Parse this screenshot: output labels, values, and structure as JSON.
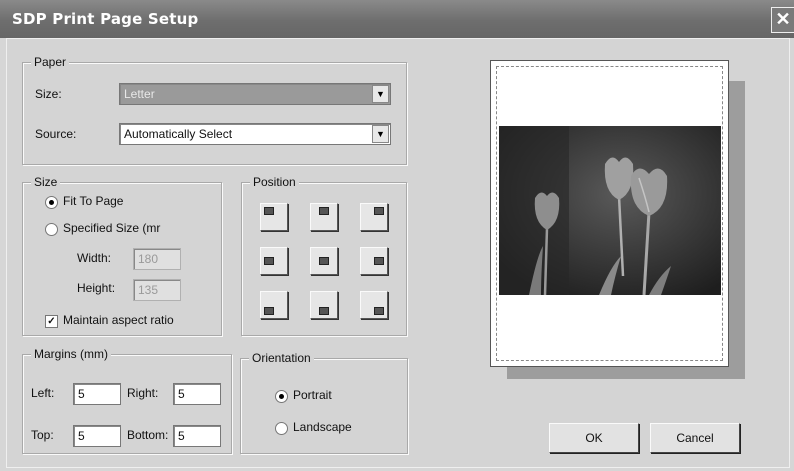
{
  "window": {
    "title": "SDP Print Page Setup",
    "close_glyph": "✕"
  },
  "paper": {
    "group_label": "Paper",
    "size_label": "Size:",
    "size_value": "Letter",
    "source_label": "Source:",
    "source_value": "Automatically Select"
  },
  "size": {
    "group_label": "Size",
    "fit_label": "Fit To Page",
    "fit_selected": true,
    "specified_label": "Specified Size (mr",
    "width_label": "Width:",
    "width_value": "180",
    "height_label": "Height:",
    "height_value": "135",
    "aspect_label": "Maintain aspect ratio",
    "aspect_checked": true
  },
  "position": {
    "group_label": "Position"
  },
  "margins": {
    "group_label": "Margins (mm)",
    "left_label": "Left:",
    "left_value": "5",
    "right_label": "Right:",
    "right_value": "5",
    "top_label": "Top:",
    "top_value": "5",
    "bottom_label": "Bottom:",
    "bottom_value": "5"
  },
  "orientation": {
    "group_label": "Orientation",
    "portrait_label": "Portrait",
    "portrait_selected": true,
    "landscape_label": "Landscape"
  },
  "buttons": {
    "ok": "OK",
    "cancel": "Cancel"
  },
  "icons": {
    "dropdown": "▼",
    "check": "✓"
  }
}
